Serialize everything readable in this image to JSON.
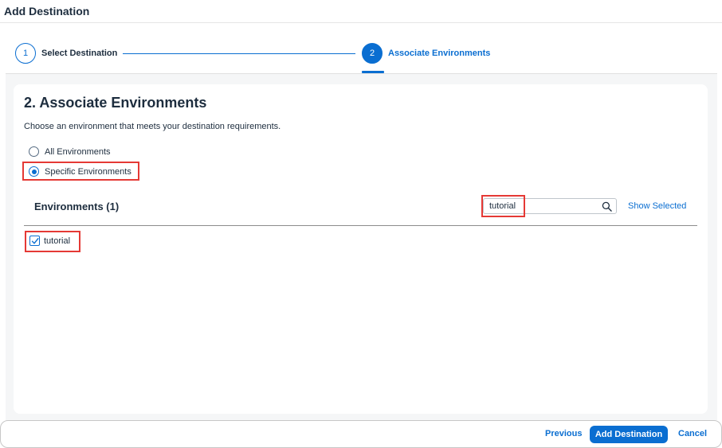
{
  "dialog": {
    "title": "Add Destination"
  },
  "wizard": {
    "steps": [
      {
        "number": "1",
        "label": "Select Destination"
      },
      {
        "number": "2",
        "label": "Associate Environments"
      }
    ]
  },
  "section": {
    "title": "2. Associate Environments",
    "description": "Choose an environment that meets your destination requirements."
  },
  "options": [
    {
      "label": "All Environments",
      "selected": false
    },
    {
      "label": "Specific Environments",
      "selected": true
    }
  ],
  "environments": {
    "title": "Environments (1)",
    "search_value": "tutorial",
    "show_selected_label": "Show Selected",
    "items": [
      {
        "label": "tutorial",
        "checked": true
      }
    ]
  },
  "footer": {
    "previous_label": "Previous",
    "add_label": "Add Destination",
    "cancel_label": "Cancel"
  },
  "colors": {
    "accent": "#0a6ed1",
    "highlight": "#e53935",
    "text": "#1d2d3e"
  }
}
